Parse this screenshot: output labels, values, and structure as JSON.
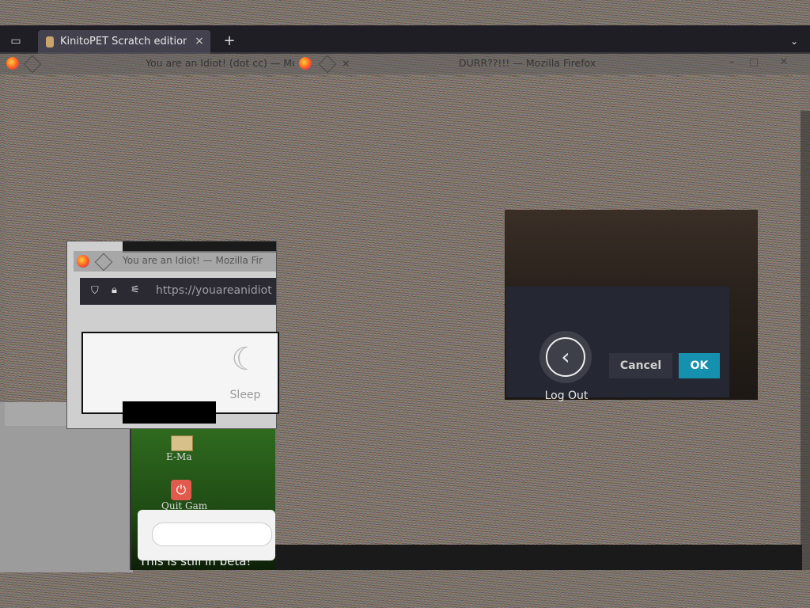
{
  "browser": {
    "tab_title": "KinitoPET Scratch edition",
    "tab_list_icon": "tab-list-icon",
    "new_tab_symbol": "+",
    "list_all_tabs_symbol": "⌄",
    "close_symbol": "×"
  },
  "windows": {
    "window_a_title": "You are an Idiot! (dot cc) — Mo",
    "window_b_title": "DURR??!!! — Mozilla Firefox",
    "window_b_tab_symbol": "×"
  },
  "idiot_window": {
    "title": "You are an Idiot! — Mozilla Fir",
    "url": "https://youareanidiot",
    "sleep_label": "Sleep",
    "sleep_icon": "moon-sleep-icon"
  },
  "desktop": {
    "email_label": "E-Ma",
    "quit_label": "Quit Gam",
    "beta_notice": "This is still in beta!"
  },
  "logout_dialog": {
    "action_label": "Log Out",
    "cancel_label": "Cancel",
    "ok_label": "OK",
    "accent_color": "#1590ae"
  }
}
